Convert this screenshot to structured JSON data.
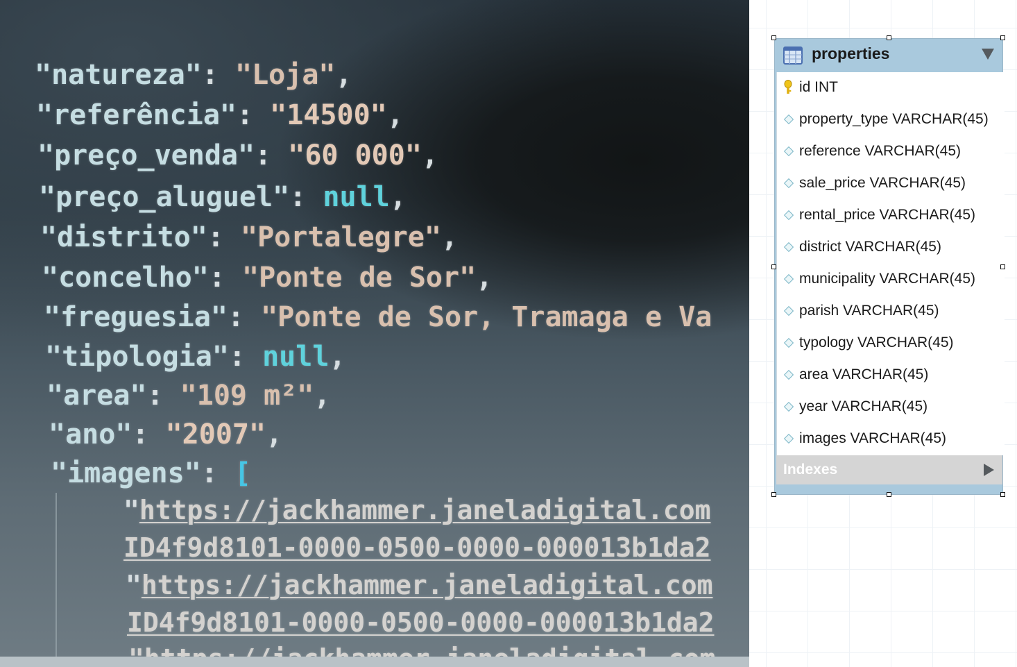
{
  "json_lines": [
    {
      "parts": [
        {
          "t": "\"natureza\"",
          "c": "key"
        },
        {
          "t": ": ",
          "c": "pun"
        },
        {
          "t": "\"Loja\"",
          "c": "str"
        },
        {
          "t": ",",
          "c": "pun"
        }
      ]
    },
    {
      "parts": [
        {
          "t": "\"referência\"",
          "c": "key"
        },
        {
          "t": ": ",
          "c": "pun"
        },
        {
          "t": "\"14500\"",
          "c": "num"
        },
        {
          "t": ",",
          "c": "pun"
        }
      ]
    },
    {
      "parts": [
        {
          "t": "\"preço_venda\"",
          "c": "key"
        },
        {
          "t": ": ",
          "c": "pun"
        },
        {
          "t": "\"60 000\"",
          "c": "num"
        },
        {
          "t": ",",
          "c": "pun"
        }
      ]
    },
    {
      "parts": [
        {
          "t": "\"preço_aluguel\"",
          "c": "key"
        },
        {
          "t": ": ",
          "c": "pun"
        },
        {
          "t": "null",
          "c": "nul"
        },
        {
          "t": ",",
          "c": "pun"
        }
      ]
    },
    {
      "parts": [
        {
          "t": "\"distrito\"",
          "c": "key"
        },
        {
          "t": ": ",
          "c": "pun"
        },
        {
          "t": "\"Portalegre\"",
          "c": "str"
        },
        {
          "t": ",",
          "c": "pun"
        }
      ]
    },
    {
      "parts": [
        {
          "t": "\"concelho\"",
          "c": "key"
        },
        {
          "t": ": ",
          "c": "pun"
        },
        {
          "t": "\"Ponte de Sor\"",
          "c": "str"
        },
        {
          "t": ",",
          "c": "pun"
        }
      ]
    },
    {
      "parts": [
        {
          "t": "\"freguesia\"",
          "c": "key"
        },
        {
          "t": ": ",
          "c": "pun"
        },
        {
          "t": "\"Ponte de Sor, Tramaga e Va",
          "c": "str"
        }
      ]
    },
    {
      "parts": [
        {
          "t": "\"tipologia\"",
          "c": "key"
        },
        {
          "t": ": ",
          "c": "pun"
        },
        {
          "t": "null",
          "c": "nul"
        },
        {
          "t": ",",
          "c": "pun"
        }
      ]
    },
    {
      "parts": [
        {
          "t": "\"area\"",
          "c": "key"
        },
        {
          "t": ": ",
          "c": "pun"
        },
        {
          "t": "\"109 m²\"",
          "c": "str"
        },
        {
          "t": ",",
          "c": "pun"
        }
      ]
    },
    {
      "parts": [
        {
          "t": "\"ano\"",
          "c": "key"
        },
        {
          "t": ": ",
          "c": "pun"
        },
        {
          "t": "\"2007\"",
          "c": "num"
        },
        {
          "t": ",",
          "c": "pun"
        }
      ]
    },
    {
      "parts": [
        {
          "t": "\"imagens\"",
          "c": "key"
        },
        {
          "t": ": ",
          "c": "pun"
        },
        {
          "t": "[",
          "c": "brk"
        }
      ]
    },
    {
      "parts": [
        {
          "t": "\"",
          "c": "pun"
        },
        {
          "t": "https://jackhammer.janeladigital.com",
          "c": "url"
        }
      ]
    },
    {
      "parts": [
        {
          "t": "ID4f9d8101-0000-0500-0000-000013b1da2",
          "c": "url"
        }
      ]
    },
    {
      "parts": [
        {
          "t": "\"",
          "c": "pun"
        },
        {
          "t": "https://jackhammer.janeladigital.com",
          "c": "url"
        }
      ]
    },
    {
      "parts": [
        {
          "t": "ID4f9d8101-0000-0500-0000-000013b1da2",
          "c": "url"
        }
      ]
    },
    {
      "parts": [
        {
          "t": "\"https://jackhammer.janeladigital.com",
          "c": "url"
        }
      ]
    }
  ],
  "entity": {
    "title": "properties",
    "columns": [
      {
        "label": "id INT",
        "icon": "primary-key-icon"
      },
      {
        "label": "property_type VARCHAR(45)",
        "icon": "column-diamond-icon"
      },
      {
        "label": "reference VARCHAR(45)",
        "icon": "column-diamond-icon"
      },
      {
        "label": "sale_price VARCHAR(45)",
        "icon": "column-diamond-icon"
      },
      {
        "label": "rental_price VARCHAR(45)",
        "icon": "column-diamond-icon"
      },
      {
        "label": "district VARCHAR(45)",
        "icon": "column-diamond-icon"
      },
      {
        "label": "municipality VARCHAR(45)",
        "icon": "column-diamond-icon"
      },
      {
        "label": "parish VARCHAR(45)",
        "icon": "column-diamond-icon"
      },
      {
        "label": "typology VARCHAR(45)",
        "icon": "column-diamond-icon"
      },
      {
        "label": "area VARCHAR(45)",
        "icon": "column-diamond-icon"
      },
      {
        "label": "year VARCHAR(45)",
        "icon": "column-diamond-icon"
      },
      {
        "label": "images VARCHAR(45)",
        "icon": "column-diamond-icon"
      }
    ],
    "indexes_label": "Indexes",
    "header_color": "#a9c9dd"
  },
  "colors": {
    "json_key": "#c5dde2",
    "json_string": "#d9c0ae",
    "json_null": "#5fd2dc",
    "json_bracket": "#46c6e6"
  }
}
